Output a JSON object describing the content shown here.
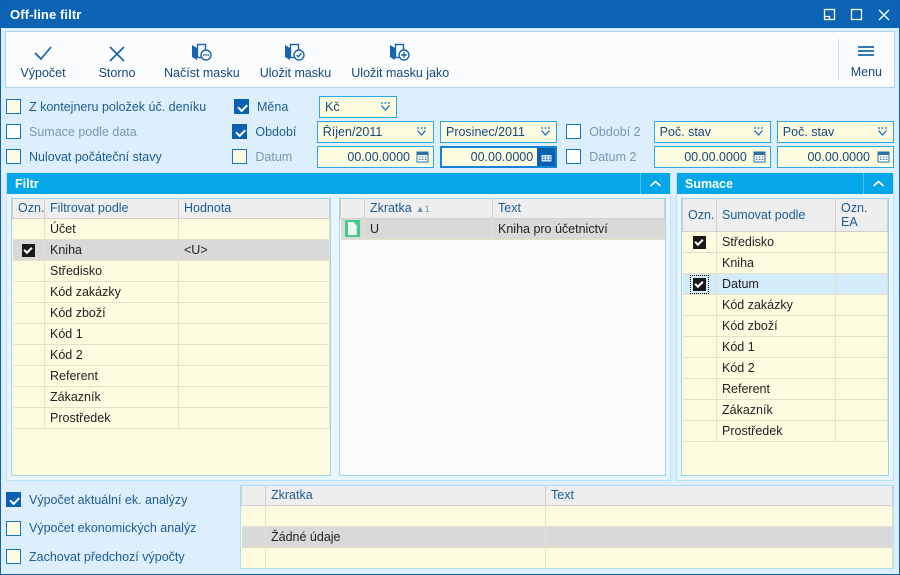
{
  "window": {
    "title": "Off-line filtr",
    "buttons": [
      {
        "name": "restore-window-button",
        "glyph": "restore"
      },
      {
        "name": "maximize-window-button",
        "glyph": "maximize"
      },
      {
        "name": "close-window-button",
        "glyph": "close"
      }
    ]
  },
  "toolbar": {
    "items": [
      {
        "label": "Výpočet",
        "icon": "check-icon"
      },
      {
        "label": "Storno",
        "icon": "close-x-icon"
      },
      {
        "label": "Načíst masku",
        "icon": "load-mask-icon"
      },
      {
        "label": "Uložit masku",
        "icon": "save-mask-icon"
      },
      {
        "label": "Uložit masku jako",
        "icon": "save-mask-as-icon"
      }
    ],
    "menu_label": "Menu"
  },
  "options": {
    "left": [
      {
        "label": "Z kontejneru položek úč. deníku",
        "checked": false,
        "style": "cream"
      },
      {
        "label": "Sumace podle data",
        "checked": false,
        "style": "white",
        "dim": true
      },
      {
        "label": "Nulovat počáteční stavy",
        "checked": false,
        "style": "cream"
      }
    ],
    "mid": [
      {
        "label": "Měna",
        "checked": true
      },
      {
        "label": "Období",
        "checked": true
      },
      {
        "label": "Datum",
        "checked": false,
        "style": "cream",
        "dim": true
      }
    ],
    "second": [
      {
        "label": "Období 2",
        "checked": false,
        "style": "white",
        "dim": true
      },
      {
        "label": "Datum 2",
        "checked": false,
        "style": "white",
        "dim": true
      }
    ],
    "fields": {
      "currency": "Kč",
      "period_from": "Říjen/2011",
      "period_to": "Prosinec/2011",
      "date_from": "00.00.0000",
      "date_to": "00.00.0000",
      "period2_from": "Poč. stav",
      "period2_to": "Poč. stav",
      "date2_from": "00.00.0000",
      "date2_to": "00.00.0000"
    }
  },
  "filtr_panel": {
    "title": "Filtr",
    "collapse_icon": "chevron-up-icon",
    "table": {
      "columns": [
        "Ozn.",
        "Filtrovat podle",
        "Hodnota"
      ],
      "rows": [
        {
          "checked": false,
          "name": "Účet",
          "value": "",
          "selected": false
        },
        {
          "checked": true,
          "name": "Kniha",
          "value": "<U>",
          "selected": true
        },
        {
          "checked": false,
          "name": "Středisko",
          "value": "",
          "selected": false
        },
        {
          "checked": false,
          "name": "Kód zakázky",
          "value": "",
          "selected": false
        },
        {
          "checked": false,
          "name": "Kód zboží",
          "value": "",
          "selected": false
        },
        {
          "checked": false,
          "name": "Kód 1",
          "value": "",
          "selected": false
        },
        {
          "checked": false,
          "name": "Kód 2",
          "value": "",
          "selected": false
        },
        {
          "checked": false,
          "name": "Referent",
          "value": "",
          "selected": false
        },
        {
          "checked": false,
          "name": "Zákazník",
          "value": "",
          "selected": false
        },
        {
          "checked": false,
          "name": "Prostředek",
          "value": "",
          "selected": false
        }
      ]
    },
    "detail": {
      "columns": [
        "",
        "Zkratka",
        "Text"
      ],
      "sort_indicator": "▲",
      "sort_order": "1",
      "rows": [
        {
          "icon": "document-icon",
          "zkratka": "U",
          "text": "Kniha pro účetnictví",
          "selected": true
        }
      ]
    }
  },
  "sumace_panel": {
    "title": "Sumace",
    "collapse_icon": "chevron-up-icon",
    "table": {
      "columns": [
        "Ozn.",
        "Sumovat podle",
        "Ozn. EA"
      ],
      "rows": [
        {
          "checked": true,
          "name": "Středisko",
          "ea": "",
          "selected": false,
          "focused": false
        },
        {
          "checked": false,
          "name": "Kniha",
          "ea": "",
          "selected": false,
          "focused": false
        },
        {
          "checked": true,
          "name": "Datum",
          "ea": "",
          "selected": true,
          "focused": true
        },
        {
          "checked": false,
          "name": "Kód zakázky",
          "ea": "",
          "selected": false,
          "focused": false
        },
        {
          "checked": false,
          "name": "Kód zboží",
          "ea": "",
          "selected": false,
          "focused": false
        },
        {
          "checked": false,
          "name": "Kód 1",
          "ea": "",
          "selected": false,
          "focused": false
        },
        {
          "checked": false,
          "name": "Kód 2",
          "ea": "",
          "selected": false,
          "focused": false
        },
        {
          "checked": false,
          "name": "Referent",
          "ea": "",
          "selected": false,
          "focused": false
        },
        {
          "checked": false,
          "name": "Zákazník",
          "ea": "",
          "selected": false,
          "focused": false
        },
        {
          "checked": false,
          "name": "Prostředek",
          "ea": "",
          "selected": false,
          "focused": false
        }
      ]
    }
  },
  "bottom": {
    "options": [
      {
        "label": "Výpočet aktuální ek. analýzy",
        "checked": true
      },
      {
        "label": "Výpočet ekonomických analýz",
        "checked": false,
        "style": "cream"
      },
      {
        "label": "Zachovat předchozí výpočty",
        "checked": false,
        "style": "cream"
      }
    ],
    "table": {
      "columns": [
        "",
        "Zkratka",
        "Text"
      ],
      "empty_message": "Žádné údaje"
    }
  },
  "colors": {
    "titlebar": "#0c63b3",
    "panel_header": "#06a7e8",
    "accent": "#29a8e8",
    "field_bg": "#fdfce0",
    "body_bg": "#ddeffc"
  }
}
